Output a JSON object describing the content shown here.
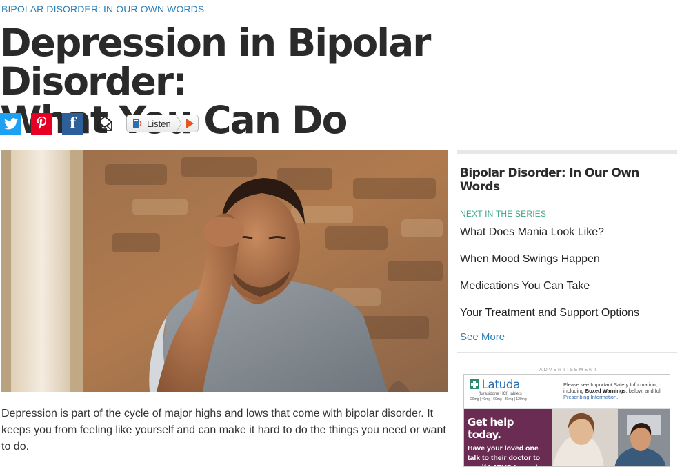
{
  "kicker": "BIPOLAR DISORDER: IN OUR OWN WORDS",
  "headline": {
    "line1": "Depression in Bipolar Disorder:",
    "line2": "What You Can Do"
  },
  "share": {
    "twitter_icon": "twitter-icon",
    "pinterest_icon": "pinterest-icon",
    "facebook_icon": "facebook-icon",
    "facebook_glyph": "f",
    "email_icon": "envelope-icon",
    "listen_label": "Listen"
  },
  "intro": "Depression is part of the cycle of major highs and lows that come with bipolar disorder. It keeps you from feeling like yourself and can make it hard to do the things you need or want to do.",
  "sidebar": {
    "series_title": "Bipolar Disorder: In Our Own Words",
    "next_label": "NEXT IN THE SERIES",
    "items": [
      {
        "label": "What Does Mania Look Like?"
      },
      {
        "label": "When Mood Swings Happen"
      },
      {
        "label": "Medications You Can Take"
      },
      {
        "label": "Your Treatment and Support Options"
      }
    ],
    "see_more": "See More"
  },
  "ad": {
    "label": "ADVERTISEMENT",
    "brand": "Latuda",
    "brand_sub": "(lurasidone HCl) tablets",
    "doses": "20mg | 40mg | 60mg | 80mg | 120mg",
    "safety_pre": "Please see Important Safety Information, including ",
    "safety_bold": "Boxed Warnings",
    "safety_mid": ", below, and full ",
    "safety_link": "Prescribing Information",
    "safety_end": ".",
    "headline": "Get help today.",
    "body": "Have your loved one talk to their doctor to see if LATUDA may be right for them."
  },
  "colors": {
    "link_blue": "#2a7fb6",
    "series_green": "#3aa88a",
    "ad_purple": "#6a2c52"
  }
}
